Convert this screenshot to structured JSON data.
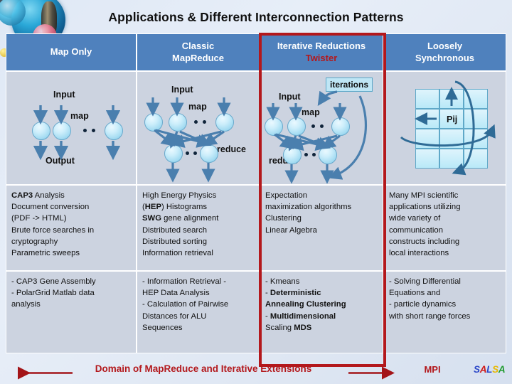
{
  "title": "Applications & Different Interconnection Patterns",
  "columns": [
    {
      "header_line1": "Map Only",
      "header_line2": "",
      "diagram": {
        "input_label": "Input",
        "map_label": "map",
        "output_label": "Output"
      },
      "apps": "CAP3 Analysis\nDocument conversion\n(PDF -> HTML)\nBrute force searches in\ncryptography\nParametric sweeps",
      "apps_bold": [
        "CAP3"
      ],
      "examples": "- CAP3 Gene Assembly\n- PolarGrid Matlab data\nanalysis",
      "examples_bold": []
    },
    {
      "header_line1": "Classic",
      "header_line2": "MapReduce",
      "diagram": {
        "input_label": "Input",
        "map_label": "map",
        "reduce_label": "reduce"
      },
      "apps": "High Energy Physics\n(HEP) Histograms\nSWG gene alignment\nDistributed search\nDistributed sorting\nInformation retrieval",
      "apps_bold": [
        "HEP",
        "SWG"
      ],
      "examples": "- Information Retrieval -\nHEP Data Analysis\n- Calculation of Pairwise\nDistances for ALU\nSequences",
      "examples_bold": []
    },
    {
      "header_line1": "Iterative Reductions",
      "header_line2": "Twister",
      "header_line2_color": "#b3181c",
      "diagram": {
        "input_label": "Input",
        "map_label": "map",
        "reduce_label": "reduce",
        "iterations_label": "iterations"
      },
      "apps": "Expectation\nmaximization algorithms\nClustering\nLinear Algebra",
      "apps_bold": [],
      "examples": "- Kmeans\n- Deterministic\nAnnealing Clustering\n- Multidimensional\nScaling MDS",
      "examples_bold": [
        "Deterministic",
        "Annealing Clustering",
        "Multidimensional",
        "MDS"
      ]
    },
    {
      "header_line1": "Loosely",
      "header_line2": "Synchronous",
      "diagram": {
        "pij_label": "Pij"
      },
      "apps": "Many MPI scientific\napplications utilizing\nwide variety of\ncommunication\nconstructs including\nlocal interactions",
      "apps_bold": [],
      "examples": "- Solving Differential\nEquations and\n- particle dynamics\nwith short range forces",
      "examples_bold": []
    }
  ],
  "footer": {
    "domain_label": "Domain of MapReduce and Iterative Extensions",
    "mpi_label": "MPI",
    "logo": [
      {
        "ch": "S",
        "color": "#2a46c8"
      },
      {
        "ch": "A",
        "color": "#d01818"
      },
      {
        "ch": "L",
        "color": "#2a46c8"
      },
      {
        "ch": "S",
        "color": "#e8b800"
      },
      {
        "ch": "A",
        "color": "#1f9b2e"
      }
    ],
    "arrow_color": "#a31418"
  },
  "colors": {
    "header_bg": "#4f81bd",
    "cell_bg": "#ccd3e0",
    "highlight_red": "#b3181c",
    "node_blue": "#a5dcf2",
    "arrow_blue": "#4a7fae"
  }
}
